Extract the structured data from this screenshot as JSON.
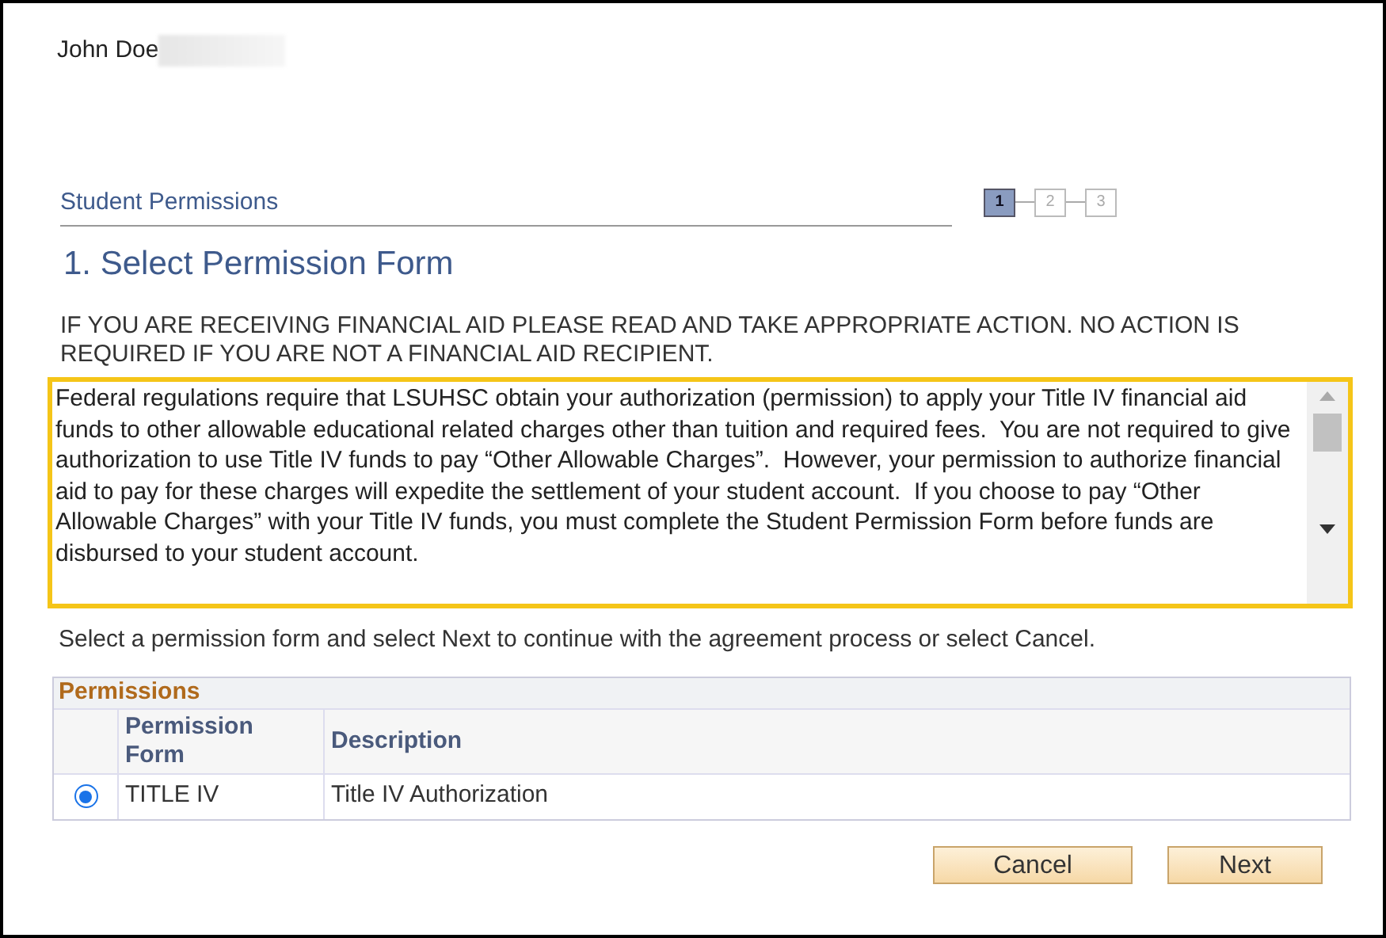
{
  "user": {
    "name": "John Doe"
  },
  "header": {
    "title": "Student Permissions"
  },
  "steps": [
    {
      "label": "1",
      "selected": true
    },
    {
      "label": "2",
      "selected": false
    },
    {
      "label": "3",
      "selected": false
    }
  ],
  "page_title": "1. Select Permission Form",
  "notice": "IF YOU ARE RECEIVING FINANCIAL AID PLEASE READ AND TAKE APPROPRIATE ACTION. NO ACTION IS REQUIRED IF YOU ARE NOT A FINANCIAL AID RECIPIENT.",
  "agreement_text": "Federal regulations require that LSUHSC obtain your authorization (permission) to apply your Title IV financial aid funds to other allowable educational related charges other than tuition and required fees.  You are not required to give authorization to use Title IV funds to pay “Other Allowable Charges”.  However, your permission to authorize financial aid to pay for these charges will expedite the settlement of your student account.  If you choose to pay “Other Allowable Charges” with your Title IV funds, you must complete the Student Permission Form before funds are disbursed to your student account.",
  "instruction": "Select a permission form and select Next to continue with the agreement process or select Cancel.",
  "table": {
    "title": "Permissions",
    "columns": [
      "Permission Form",
      "Description"
    ],
    "rows": [
      {
        "selected": true,
        "cells": [
          "TITLE IV",
          "Title IV Authorization"
        ]
      }
    ]
  },
  "buttons": [
    "Cancel",
    "Next"
  ]
}
